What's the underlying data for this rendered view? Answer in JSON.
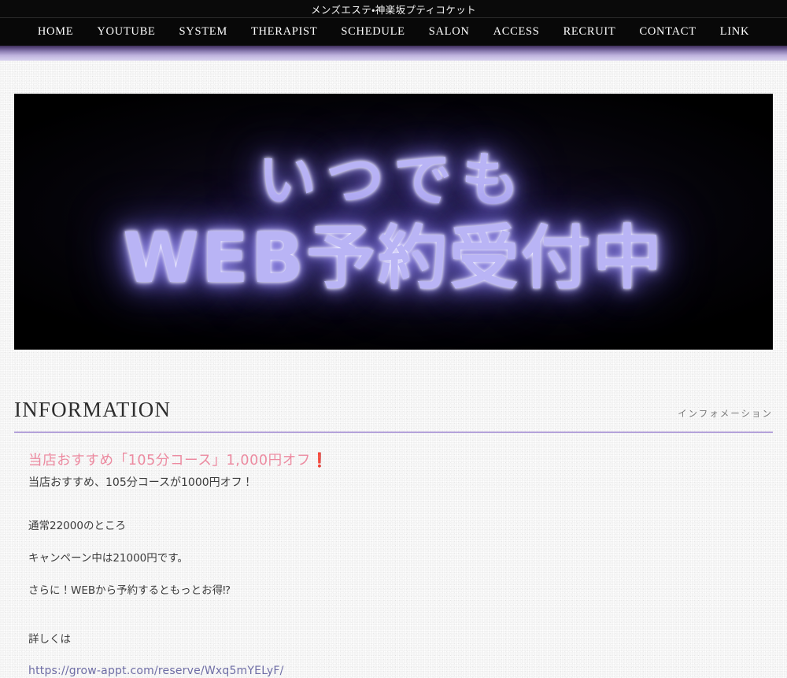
{
  "site": {
    "title": "メンズエステ・神楽坂プティコケット"
  },
  "nav": {
    "items": [
      {
        "label": "HOME",
        "name": "nav-item-home"
      },
      {
        "label": "YOUTUBE",
        "name": "nav-item-youtube"
      },
      {
        "label": "SYSTEM",
        "name": "nav-item-system"
      },
      {
        "label": "THERAPIST",
        "name": "nav-item-therapist"
      },
      {
        "label": "SCHEDULE",
        "name": "nav-item-schedule"
      },
      {
        "label": "SALON",
        "name": "nav-item-salon"
      },
      {
        "label": "ACCESS",
        "name": "nav-item-access"
      },
      {
        "label": "RECRUIT",
        "name": "nav-item-recruit"
      },
      {
        "label": "CONTACT",
        "name": "nav-item-contact"
      },
      {
        "label": "LINK",
        "name": "nav-item-link"
      }
    ]
  },
  "hero": {
    "line1": "いつでも",
    "line2": "WEB予約受付中",
    "neon_color": "#b9b4f5",
    "background_color": "#000000"
  },
  "information": {
    "heading": "INFORMATION",
    "subheading": "インフォメーション",
    "rule_color": "#b4a2da"
  },
  "article": {
    "headline": "当店おすすめ「105分コース」1,000円オフ",
    "headline_mark": "❗",
    "headline_color": "#ec8aa0",
    "lead": "当店おすすめ、105分コースが1000円オフ！",
    "paragraphs": [
      "通常22000のところ",
      "キャンペーン中は21000円です。",
      "さらに！WEBから予約するともっとお得⁉"
    ],
    "detail_label": "詳しくは",
    "link_text": "https://grow-appt.com/reserve/Wxq5mYELyF/",
    "link_color": "#6e6da5"
  },
  "theme": {
    "accent_strip_top": "#3d2f58",
    "accent_strip_bottom": "#d7d0ed",
    "page_background": "#f2f2f2",
    "header_background": "#080808"
  }
}
